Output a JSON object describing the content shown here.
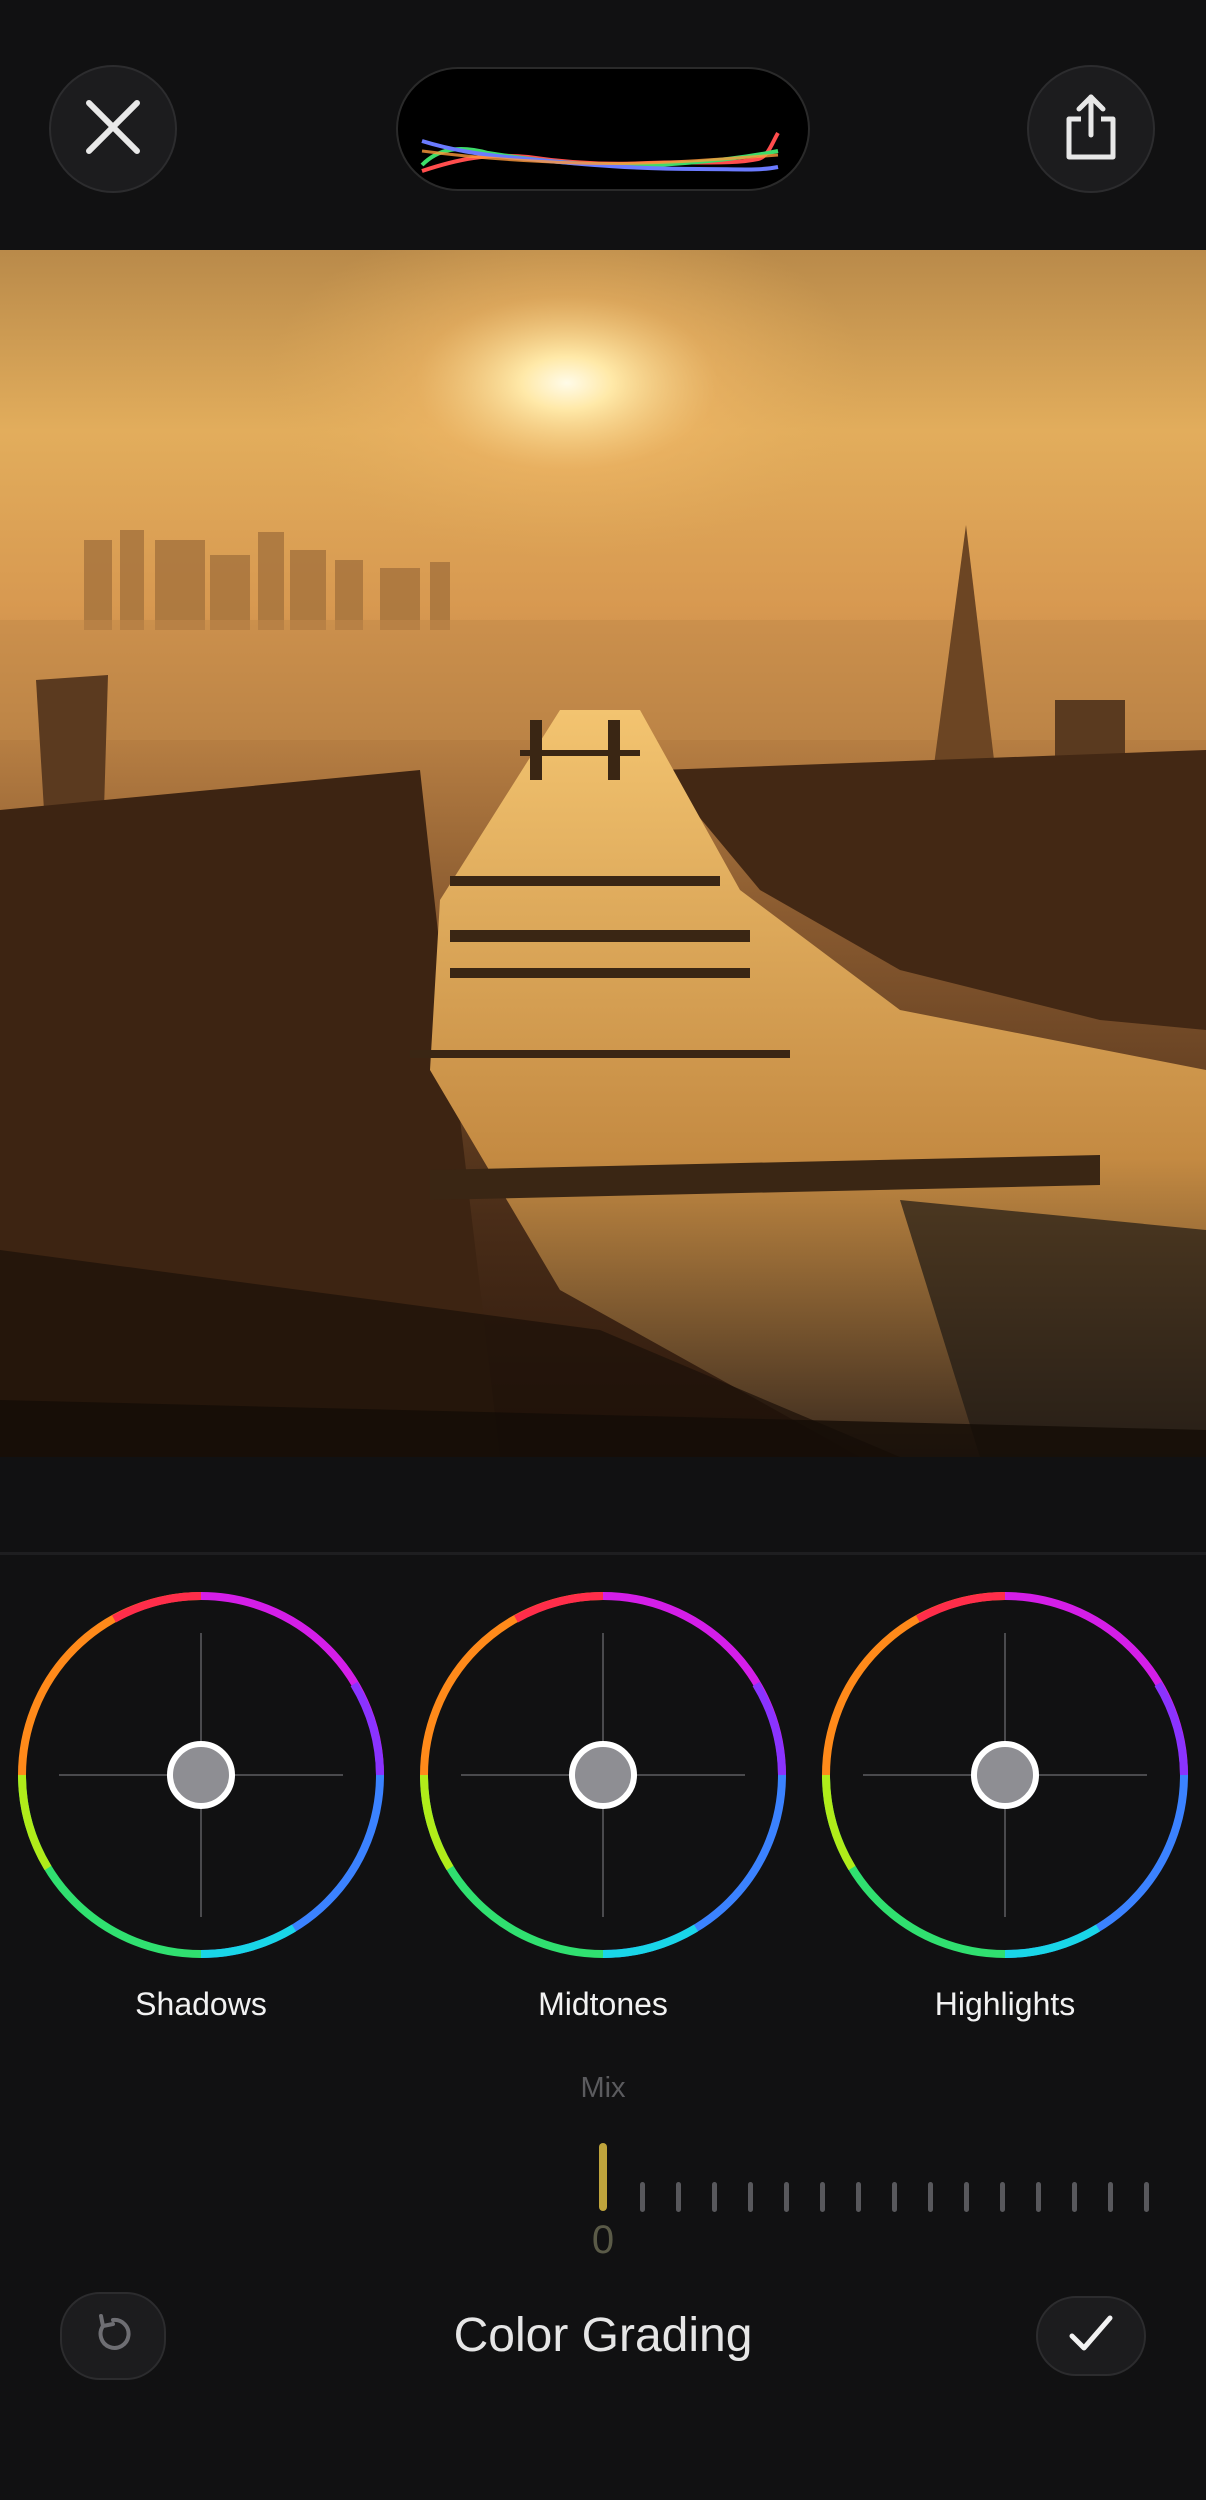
{
  "toolbar": {
    "close_icon": "close-icon",
    "share_icon": "share-icon"
  },
  "histogram": {
    "channels": [
      "red",
      "green",
      "blue"
    ],
    "colors": {
      "red": "#ff4d4d",
      "green": "#3ddc6a",
      "blue": "#6b7bff"
    }
  },
  "wheels": [
    {
      "label": "Shadows"
    },
    {
      "label": "Midtones"
    },
    {
      "label": "Highlights"
    }
  ],
  "mix": {
    "label": "Mix",
    "value": "0",
    "accent": "#bfa43c"
  },
  "bottom": {
    "title": "Color Grading",
    "reset_icon": "reset-icon",
    "confirm_icon": "checkmark-icon"
  }
}
